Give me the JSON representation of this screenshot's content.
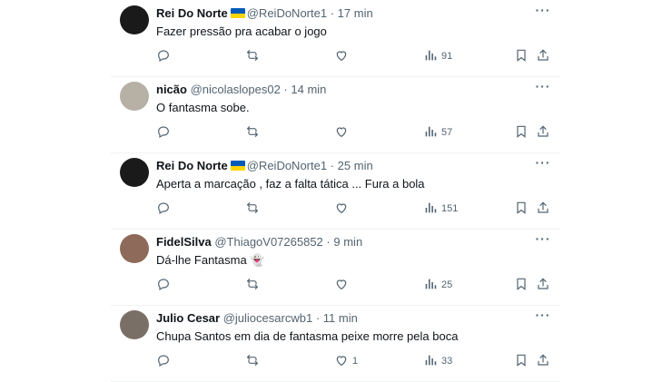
{
  "tweets": [
    {
      "name": "Rei Do Norte",
      "has_flag": true,
      "handle": "@ReiDoNorte1",
      "sep": "·",
      "time": "17 min",
      "text": "Fazer pressão pra acabar o jogo",
      "likes": "",
      "views": "91",
      "avatar_color": "#1a1a1a"
    },
    {
      "name": "nicão",
      "has_flag": false,
      "handle": "@nicolaslopes02",
      "sep": "·",
      "time": "14 min",
      "text": "O fantasma sobe.",
      "likes": "",
      "views": "57",
      "avatar_color": "#b7b0a4"
    },
    {
      "name": "Rei Do Norte",
      "has_flag": true,
      "handle": "@ReiDoNorte1",
      "sep": "·",
      "time": "25 min",
      "text": "Aperta a marcação , faz a falta tática ... Fura a bola",
      "likes": "",
      "views": "151",
      "avatar_color": "#1a1a1a"
    },
    {
      "name": "FidelSilva",
      "has_flag": false,
      "handle": "@ThiagoV07265852",
      "sep": "·",
      "time": "9 min",
      "text": "Dá-lhe Fantasma 👻",
      "likes": "",
      "views": "25",
      "avatar_color": "#8e6a5a"
    },
    {
      "name": "Julio Cesar",
      "has_flag": false,
      "handle": "@juliocesarcwb1",
      "sep": "·",
      "time": "11 min",
      "text": "Chupa Santos em dia de fantasma peixe morre pela boca",
      "likes": "1",
      "views": "33",
      "avatar_color": "#7a6f66"
    }
  ],
  "colors": {
    "text": "#0f1419",
    "meta": "#536471",
    "divider": "#eff3f4"
  }
}
